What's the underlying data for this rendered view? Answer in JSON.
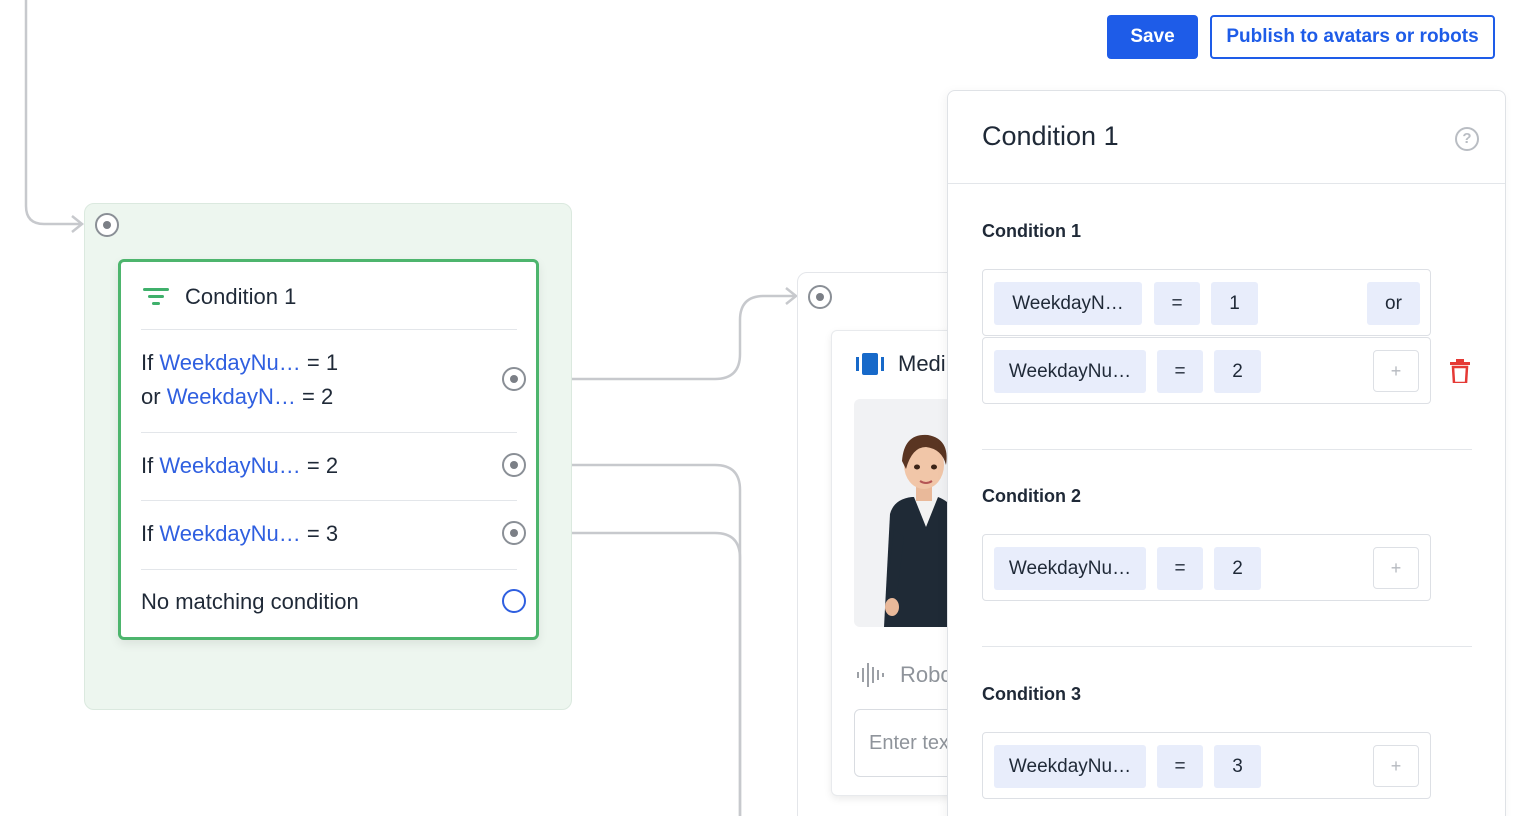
{
  "toolbar": {
    "save_label": "Save",
    "publish_label": "Publish to avatars or robots"
  },
  "condition_node": {
    "title": "Condition 1",
    "rows": [
      {
        "prefix": "If",
        "variable": "WeekdayNu…",
        "op_value": "= 1",
        "second_prefix": "or",
        "second_variable": "WeekdayN…",
        "second_op_value": "= 2"
      },
      {
        "prefix": "If",
        "variable": "WeekdayNu…",
        "op_value": "= 2"
      },
      {
        "prefix": "If",
        "variable": "WeekdayNu…",
        "op_value": "= 3"
      },
      {
        "label": "No matching condition"
      }
    ]
  },
  "media_node": {
    "title": "Medi",
    "robot_label": "Robo",
    "input_placeholder": "Enter tex"
  },
  "panel": {
    "title": "Condition 1",
    "help": "?",
    "sections": [
      {
        "label": "Condition 1",
        "clauses": [
          {
            "variable": "WeekdayN…",
            "operator": "=",
            "value": "1",
            "join": "or"
          },
          {
            "variable": "WeekdayNu…",
            "operator": "=",
            "value": "2",
            "add": "+"
          }
        ]
      },
      {
        "label": "Condition 2",
        "clauses": [
          {
            "variable": "WeekdayNu…",
            "operator": "=",
            "value": "2",
            "add": "+"
          }
        ]
      },
      {
        "label": "Condition 3",
        "clauses": [
          {
            "variable": "WeekdayNu…",
            "operator": "=",
            "value": "3",
            "add": "+"
          }
        ]
      }
    ]
  },
  "colors": {
    "accent": "#1e5ce8",
    "condition_border": "#4db56d",
    "group_bg": "#edf6ef",
    "variable_text": "#2f5fe0",
    "chip_bg": "#e8edfb",
    "delete": "#e53935"
  }
}
